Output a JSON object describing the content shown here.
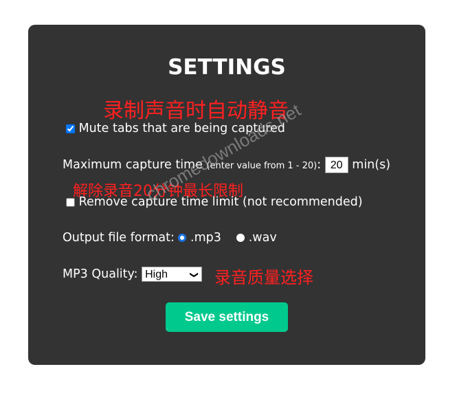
{
  "title": "SETTINGS",
  "annotations": {
    "mute": "录制声音时自动静音",
    "limit": "解除录音20分钟最长限制",
    "quality": "录音质量选择"
  },
  "mute": {
    "label": "Mute tabs that are being captured",
    "checked": true
  },
  "max_time": {
    "label": "Maximum capture time",
    "hint": "(enter value from 1 - 20)",
    "colon": ":",
    "value": "20",
    "unit": "min(s)"
  },
  "remove_limit": {
    "label": "Remove capture time limit (not recommended)",
    "checked": false
  },
  "format": {
    "label": "Output file format:",
    "options": [
      ".mp3",
      ".wav"
    ],
    "selected": ".mp3"
  },
  "quality": {
    "label": "MP3 Quality:",
    "selected": "High"
  },
  "save_label": "Save settings",
  "watermark": "chromedownloads.net",
  "colors": {
    "panel": "#333333",
    "button": "#00c98d",
    "annotation": "#ff2020"
  }
}
